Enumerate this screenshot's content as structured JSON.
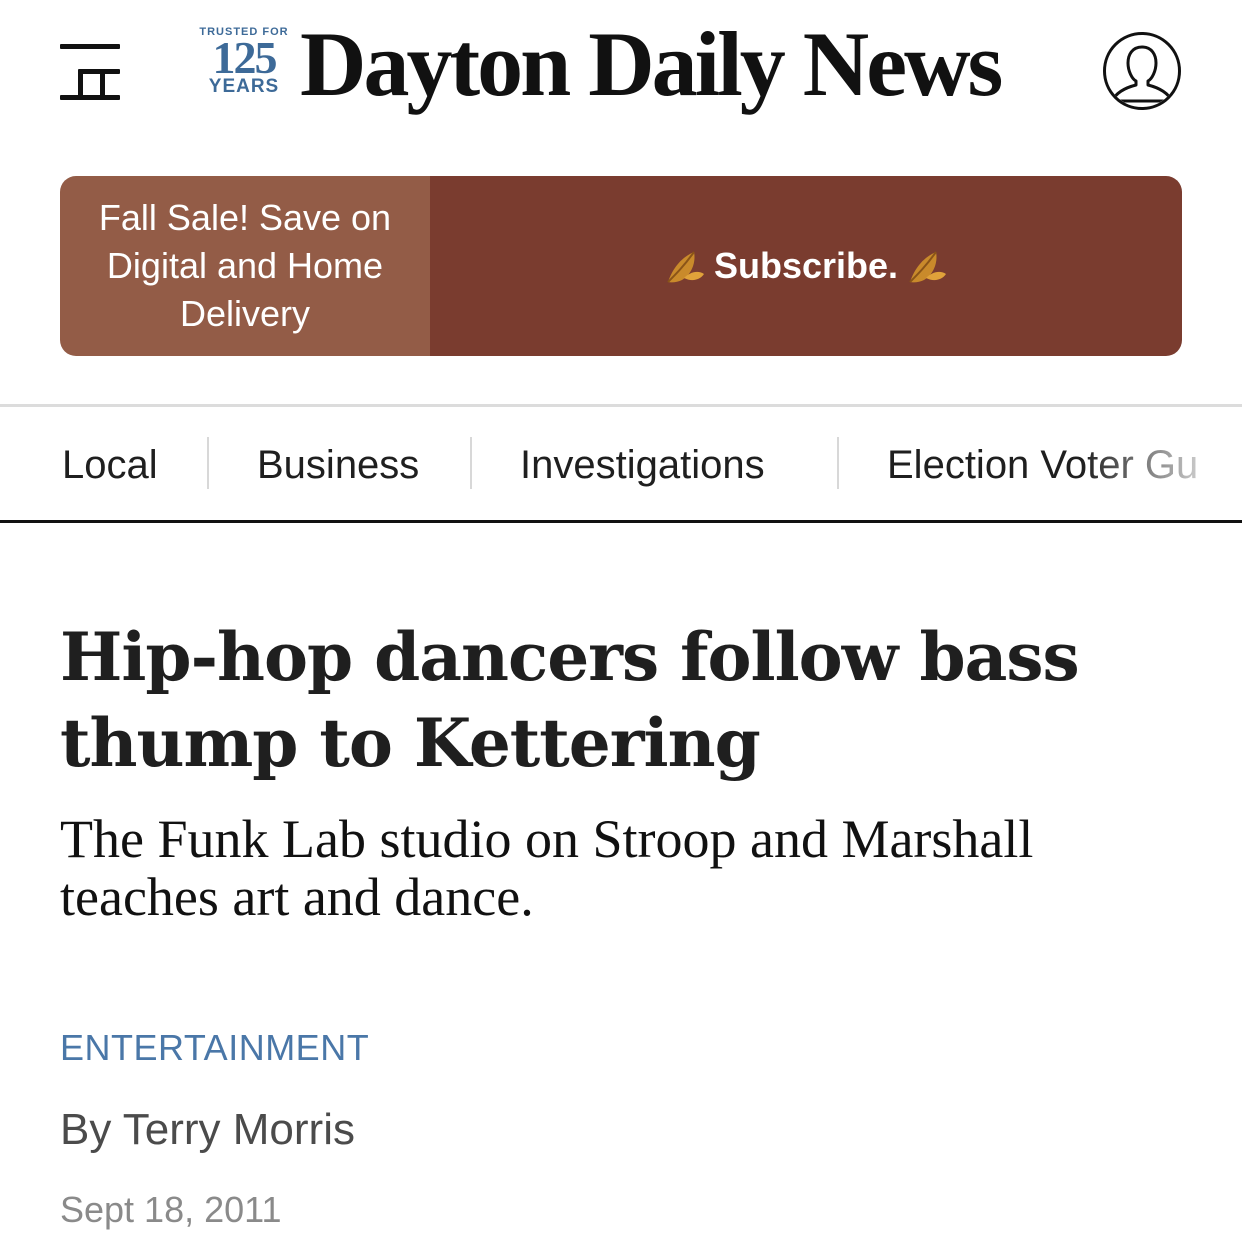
{
  "header": {
    "badge": {
      "top": "TRUSTED FOR",
      "number": "125",
      "bottom": "YEARS"
    },
    "wordmark": "Dayton Daily News",
    "icons": {
      "menu": "hamburger-menu-icon",
      "account": "user-account-icon"
    }
  },
  "promo": {
    "offer": "Fall Sale! Save on Digital and Home Delivery",
    "cta": "Subscribe.",
    "icon": "leaf-icon",
    "colors": {
      "offer_bg": "#935c47",
      "cta_bg": "#7a3c2f"
    }
  },
  "nav": {
    "items": [
      {
        "label": "Local"
      },
      {
        "label": "Business"
      },
      {
        "label": "Investigations"
      },
      {
        "label": "Election Voter Gu"
      }
    ]
  },
  "article": {
    "headline": "Hip-hop dancers follow bass thump to Kettering",
    "dek": "The Funk Lab studio on Stroop and Marshall teaches art and dance.",
    "section": "ENTERTAINMENT",
    "byline": "By Terry Morris",
    "date": "Sept 18, 2011",
    "colors": {
      "section": "#4a77a8"
    }
  }
}
